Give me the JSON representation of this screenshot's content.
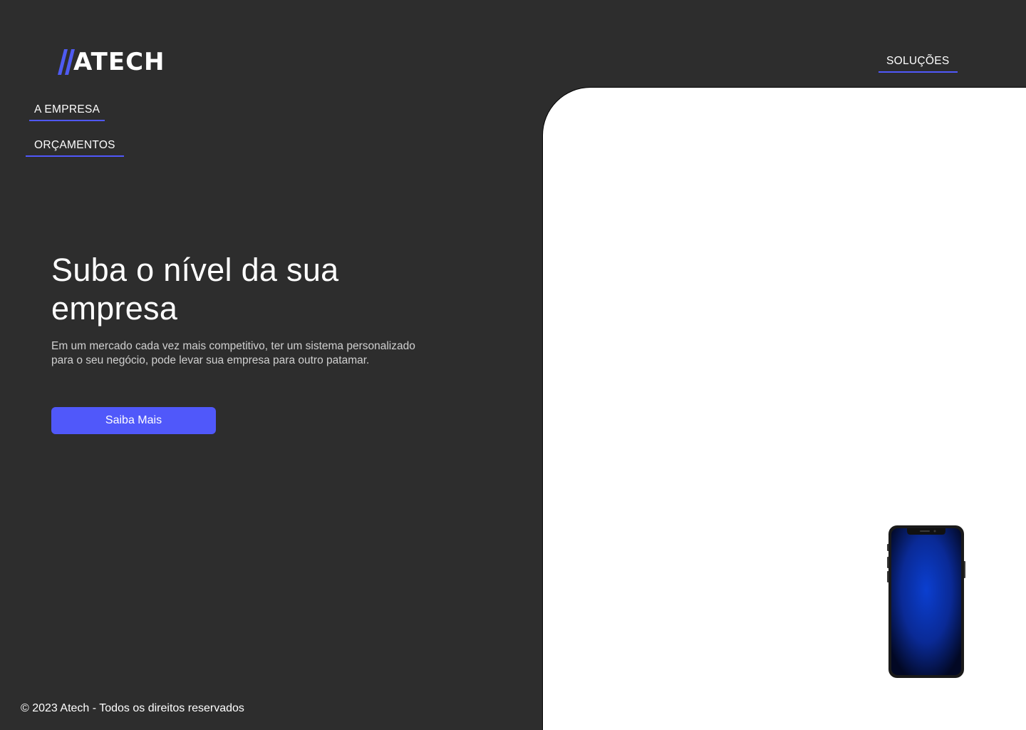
{
  "brand": {
    "name": "ATECH",
    "slash_color": "#4f5bf2"
  },
  "nav": {
    "empresa": "A EMPRESA",
    "orcamentos": "ORÇAMENTOS",
    "solucoes": "SOLUÇÕES"
  },
  "hero": {
    "title": "Suba o nível da sua empresa",
    "description": "Em um mercado cada vez mais competitivo, ter um sistema personalizado para o seu negócio, pode levar sua empresa para outro patamar.",
    "cta_label": "Saiba Mais"
  },
  "footer": {
    "copyright": "© 2023 Atech - Todos os direitos reservados"
  },
  "colors": {
    "background": "#2d2d2d",
    "accent": "#5058fa",
    "panel": "#ffffff"
  },
  "icons": {
    "phone": "smartphone-mockup-icon"
  }
}
